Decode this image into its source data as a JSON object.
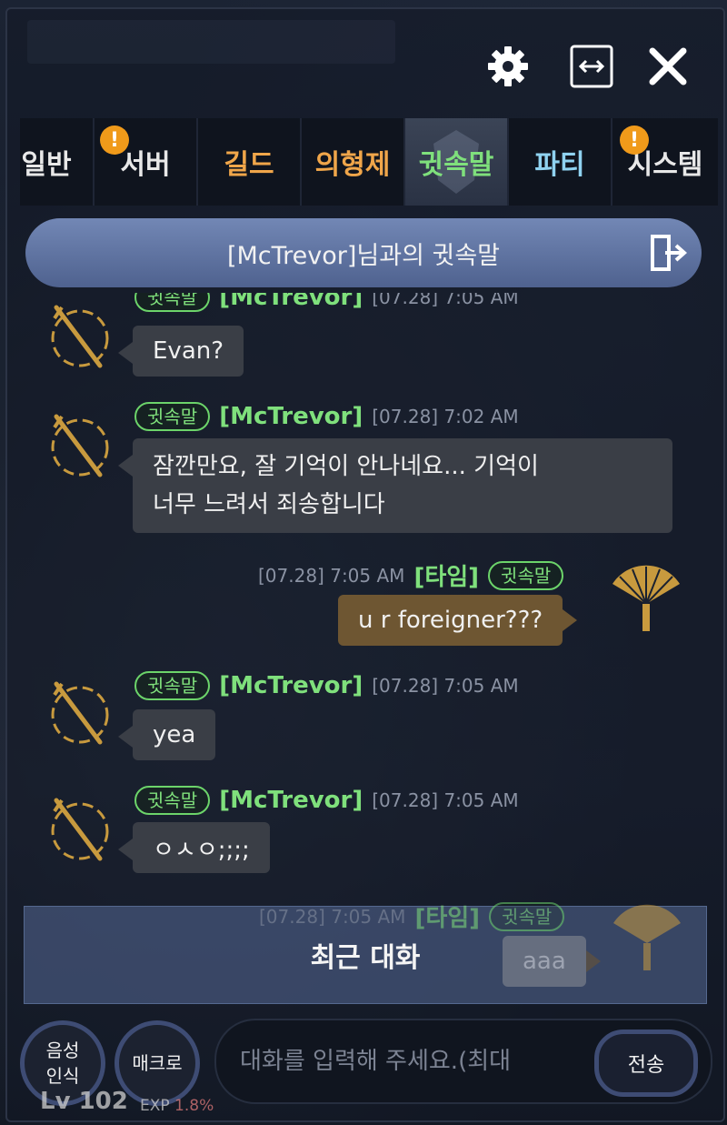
{
  "window": {
    "settings_icon": "gear-icon",
    "expand_icon": "expand-horizontal-icon",
    "close_icon": "close-icon"
  },
  "tabs": [
    {
      "label": "일반",
      "color": "#e8e8e8",
      "badge": false
    },
    {
      "label": "서버",
      "color": "#e8e8e8",
      "badge": true,
      "badge_text": "!"
    },
    {
      "label": "길드",
      "color": "#f0a64a",
      "badge": false
    },
    {
      "label": "의형제",
      "color": "#f0a64a",
      "badge": false
    },
    {
      "label": "귓속말",
      "color": "#7fe07c",
      "badge": false,
      "active": true
    },
    {
      "label": "파티",
      "color": "#8fd2f0",
      "badge": false
    },
    {
      "label": "시스템",
      "color": "#e8e8e8",
      "badge": true,
      "badge_text": "!"
    }
  ],
  "header": {
    "title": "[McTrevor]님과의 귓속말",
    "exit_icon": "exit-door-icon"
  },
  "messages": [
    {
      "side": "left",
      "tag": "귓속말",
      "name": "[McTrevor]",
      "time": "[07.28] 7:05 AM",
      "lines": [
        "Evan?"
      ],
      "partial": true
    },
    {
      "side": "left",
      "tag": "귓속말",
      "name": "[McTrevor]",
      "time": "[07.28] 7:02 AM",
      "lines": [
        "잠깐만요, 잘 기억이 안나네요... 기억이",
        "너무 느려서 죄송합니다"
      ]
    },
    {
      "side": "right",
      "tag": "귓속말",
      "name": "[타임]",
      "time": "[07.28] 7:05 AM",
      "lines": [
        "u r foreigner???"
      ]
    },
    {
      "side": "left",
      "tag": "귓속말",
      "name": "[McTrevor]",
      "time": "[07.28] 7:05 AM",
      "lines": [
        "yea"
      ]
    },
    {
      "side": "left",
      "tag": "귓속말",
      "name": "[McTrevor]",
      "time": "[07.28] 7:05 AM",
      "lines": [
        "ㅇㅅㅇ;;;;"
      ]
    },
    {
      "side": "right",
      "tag": "귓속말",
      "name": "[타임]",
      "time": "[07.28] 7:05 AM",
      "lines": [
        "aaa"
      ]
    }
  ],
  "recent": {
    "label": "최근 대화"
  },
  "bottom": {
    "voice_label_1": "음성",
    "voice_label_2": "인식",
    "macro_label": "매크로",
    "input_placeholder": "대화를 입력해 주세요.(최대",
    "send_label": "전송",
    "level": "Lv 102",
    "exp_label": "EXP",
    "exp_value": "1.8%"
  }
}
